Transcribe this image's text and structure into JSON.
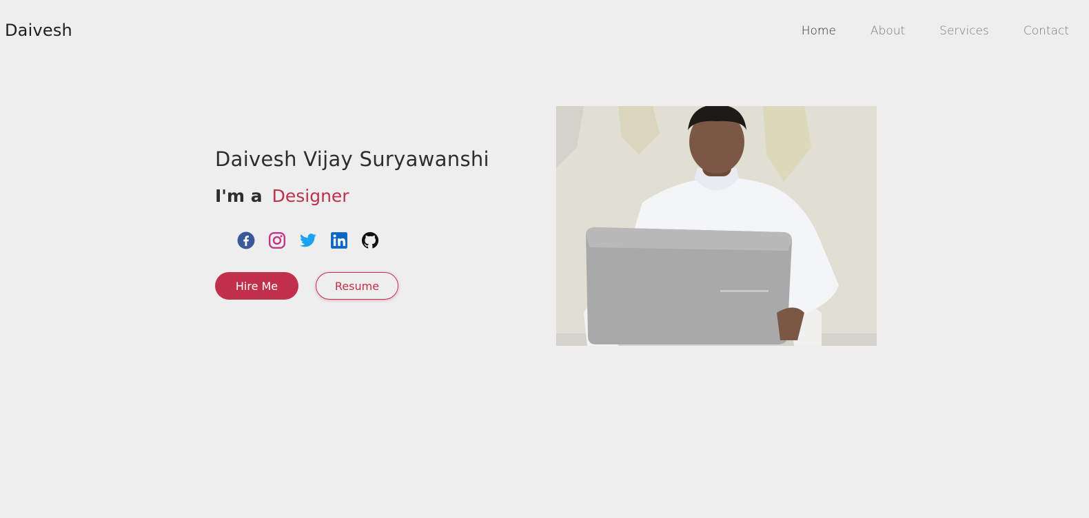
{
  "header": {
    "brand": "Daivesh",
    "nav": [
      {
        "label": "Home",
        "active": true
      },
      {
        "label": "About",
        "active": false
      },
      {
        "label": "Services",
        "active": false
      },
      {
        "label": "Contact",
        "active": false
      }
    ]
  },
  "hero": {
    "name": "Daivesh Vijay Suryawanshi",
    "tagline_prefix": "I'm a",
    "role": "Designer",
    "socials": [
      {
        "icon": "facebook-icon",
        "color": "#3b5998"
      },
      {
        "icon": "instagram-icon",
        "color": "#c13584"
      },
      {
        "icon": "twitter-icon",
        "color": "#1da1f2"
      },
      {
        "icon": "linkedin-icon",
        "color": "#0a66c2"
      },
      {
        "icon": "github-icon",
        "color": "#111111"
      }
    ],
    "buttons": {
      "hire": "Hire Me",
      "resume": "Resume"
    },
    "accent_color": "#c0304a"
  }
}
